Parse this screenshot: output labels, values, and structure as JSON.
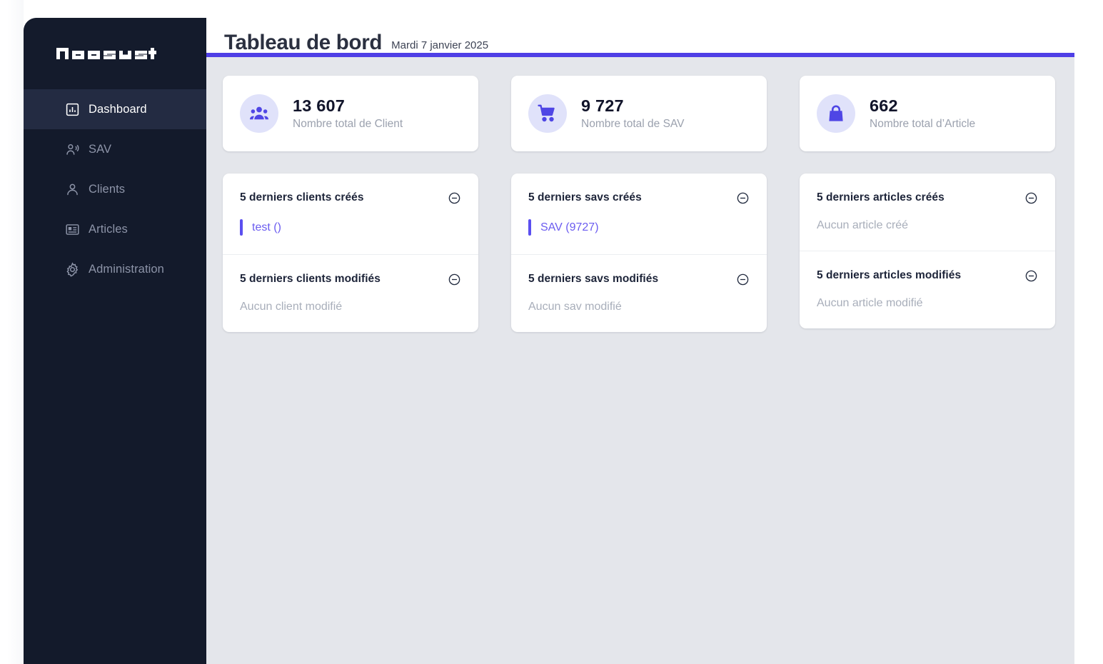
{
  "brand": {
    "logo_text": "NEOSYST"
  },
  "accent_colors": {
    "purple": "#4F3FE6",
    "link_purple": "#6B5CF0",
    "icon_purple": "#4F46E5",
    "icon_circle_bg": "#E0E2FA",
    "sidebar_bg": "#131A2B",
    "sidebar_logo_bg": "#141B2C",
    "sidebar_active_bg": "#232B42",
    "content_bg": "#E4E6EB"
  },
  "sidebar": {
    "items": [
      {
        "label": "Dashboard",
        "icon": "bar-chart-box-icon",
        "active": true
      },
      {
        "label": "SAV",
        "icon": "user-voice-icon",
        "active": false
      },
      {
        "label": "Clients",
        "icon": "user-icon",
        "active": false
      },
      {
        "label": "Articles",
        "icon": "id-card-icon",
        "active": false
      },
      {
        "label": "Administration",
        "icon": "gear-icon",
        "active": false
      }
    ]
  },
  "header": {
    "title": "Tableau de bord",
    "date": "Mardi 7 janvier 2025"
  },
  "stats": [
    {
      "value": "13 607",
      "label": "Nombre total de Client",
      "icon": "group-icon"
    },
    {
      "value": "9 727",
      "label": "Nombre total de SAV",
      "icon": "shopping-cart-icon"
    },
    {
      "value": "662",
      "label": "Nombre total d’Article",
      "icon": "handbag-icon"
    }
  ],
  "panels": [
    {
      "sections": [
        {
          "title": "5 derniers clients créés",
          "collapse_icon": "minus-circle-icon",
          "items": [
            {
              "text": "test ()"
            }
          ],
          "empty": ""
        },
        {
          "title": "5 derniers clients modifiés",
          "collapse_icon": "minus-circle-icon",
          "items": [],
          "empty": "Aucun client modifié"
        }
      ]
    },
    {
      "sections": [
        {
          "title": "5 derniers savs créés",
          "collapse_icon": "minus-circle-icon",
          "items": [
            {
              "text": "SAV (9727)"
            }
          ],
          "empty": ""
        },
        {
          "title": "5 derniers savs modifiés",
          "collapse_icon": "minus-circle-icon",
          "items": [],
          "empty": "Aucun sav modifié"
        }
      ]
    },
    {
      "sections": [
        {
          "title": "5 derniers articles créés",
          "collapse_icon": "minus-circle-icon",
          "items": [],
          "empty": "Aucun article créé"
        },
        {
          "title": "5 derniers articles modifiés",
          "collapse_icon": "minus-circle-icon",
          "items": [],
          "empty": "Aucun article modifié"
        }
      ]
    }
  ]
}
